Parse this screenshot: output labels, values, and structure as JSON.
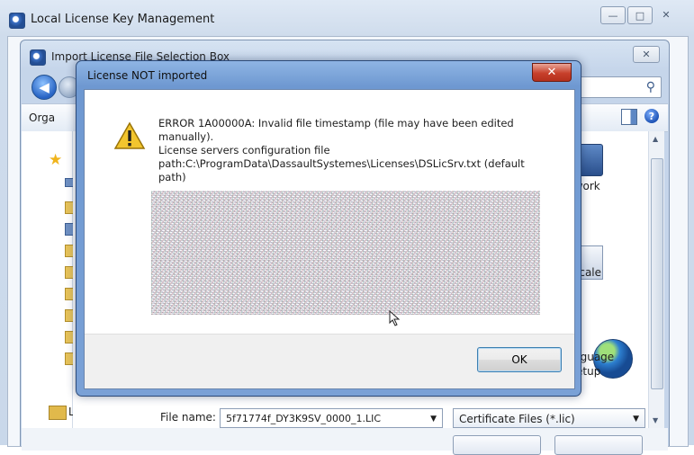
{
  "outer_window": {
    "title": "Local License Key Management",
    "controls": {
      "minimize": "—",
      "maximize": "□",
      "close": "✕"
    }
  },
  "file_dialog": {
    "title": "Import License File Selection Box",
    "close": "✕",
    "toolbar": {
      "organize": "Orga"
    },
    "nav": {
      "libraries": "L"
    },
    "items": [
      {
        "label": "twork",
        "icon": "network-icon"
      },
      {
        "label": "ocale",
        "icon": "locale-icon"
      },
      {
        "label": "nguage",
        "label2": "etup",
        "icon": "globe-icon"
      }
    ],
    "file_name_label": "File name:",
    "file_name_value": "5f71774f_DY3K9SV_0000_1.LIC",
    "file_type_filter": "Certificate Files (*.lic)"
  },
  "error_dialog": {
    "title": "License NOT imported",
    "close": "✕",
    "message_lines": [
      "ERROR 1A00000A:  Invalid file timestamp (file may have been edited",
      "manually).",
      "License servers configuration file",
      "path:C:\\ProgramData\\DassaultSystemes\\Licenses\\DSLicSrv.txt (default",
      "path)"
    ],
    "ok_label": "OK"
  },
  "colors": {
    "dialog_frame": "#7aa1d6",
    "close_red": "#c7402b",
    "warning_yellow": "#f2c52e"
  }
}
